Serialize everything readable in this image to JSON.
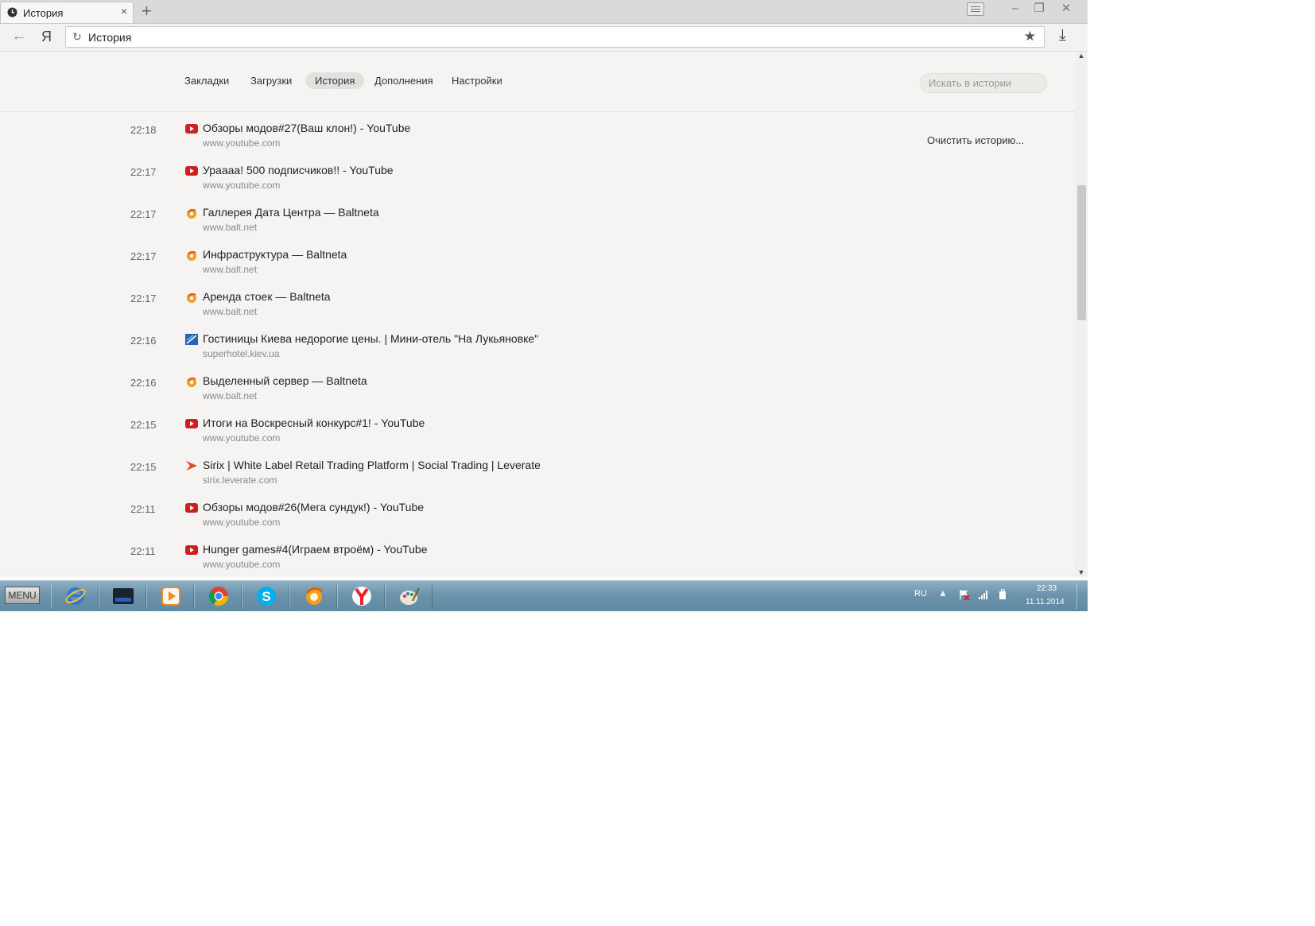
{
  "window": {
    "tab_title": "История",
    "tab_close": "×",
    "new_tab": "+",
    "minimize": "–",
    "restore": "❐",
    "close": "✕"
  },
  "toolbar": {
    "back": "←",
    "yandex": "Я",
    "address": "История",
    "reload": "↻",
    "bookmark": "★",
    "download": "⤓"
  },
  "nav": {
    "items": [
      "Закладки",
      "Загрузки",
      "История",
      "Дополнения",
      "Настройки"
    ],
    "active": "История",
    "search_placeholder": "Искать в истории",
    "clear_history": "Очистить историю..."
  },
  "history": [
    {
      "time": "22:18",
      "title": "Обзоры модов#27(Ваш клон!) - YouTube",
      "url": "www.youtube.com",
      "icon": "youtube-icon"
    },
    {
      "time": "22:17",
      "title": "Ураааа! 500 подписчиков!! - YouTube",
      "url": "www.youtube.com",
      "icon": "youtube-icon"
    },
    {
      "time": "22:17",
      "title": "Галлерея Дата Центра — Baltneta",
      "url": "www.balt.net",
      "icon": "baltneta-icon"
    },
    {
      "time": "22:17",
      "title": "Инфраструктура — Baltneta",
      "url": "www.balt.net",
      "icon": "baltneta-icon"
    },
    {
      "time": "22:17",
      "title": "Аренда стоек — Baltneta",
      "url": "www.balt.net",
      "icon": "baltneta-icon"
    },
    {
      "time": "22:16",
      "title": "Гостиницы Киева недорогие цены. | Мини-отель \"На Лукьяновке\"",
      "url": "superhotel.kiev.ua",
      "icon": "superhotel-icon"
    },
    {
      "time": "22:16",
      "title": "Выделенный сервер — Baltneta",
      "url": "www.balt.net",
      "icon": "baltneta-icon"
    },
    {
      "time": "22:15",
      "title": "Итоги на Воскресный конкурс#1! - YouTube",
      "url": "www.youtube.com",
      "icon": "youtube-icon"
    },
    {
      "time": "22:15",
      "title": "Sirix | White Label Retail Trading Platform | Social Trading | Leverate",
      "url": "sirix.leverate.com",
      "icon": "leverate-icon"
    },
    {
      "time": "22:11",
      "title": "Обзоры модов#26(Мега сундук!) - YouTube",
      "url": "www.youtube.com",
      "icon": "youtube-icon"
    },
    {
      "time": "22:11",
      "title": "Hunger games#4(Играем втроём) - YouTube",
      "url": "www.youtube.com",
      "icon": "youtube-icon"
    }
  ],
  "taskbar": {
    "menu_label": "MENU",
    "apps": [
      "internet-explorer-icon",
      "media-center-icon",
      "video-player-icon",
      "chrome-icon",
      "skype-icon",
      "paw-browser-icon",
      "yandex-browser-icon",
      "paint-icon"
    ],
    "lang": "RU",
    "tray_arrow": "▲",
    "time": "22:33",
    "date": "11.11.2014"
  },
  "colors": {
    "page_bg": "#f5f4f2",
    "youtube_red": "#cc1f1f",
    "baltneta_orange": "#f0a020",
    "active_pill": "#e2e1de"
  }
}
